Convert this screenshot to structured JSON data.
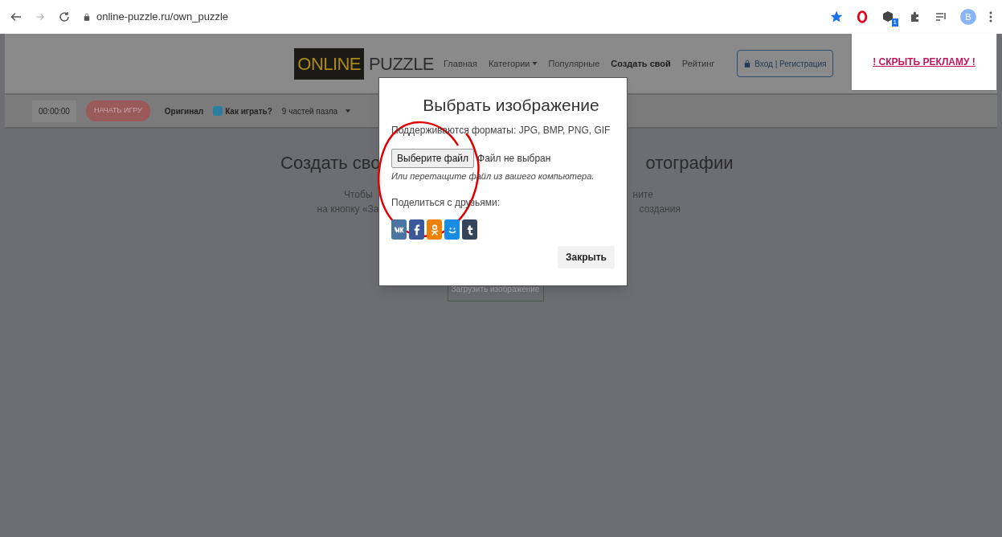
{
  "browser": {
    "url": "online-puzzle.ru/own_puzzle",
    "profile": "B",
    "badge": "1"
  },
  "site": {
    "logo_left": "ONLINE",
    "logo_right": "PUZZLE",
    "nav": [
      {
        "label": "Главная",
        "selected": false,
        "dropdown": false
      },
      {
        "label": "Категории",
        "selected": false,
        "dropdown": true
      },
      {
        "label": "Популярные",
        "selected": false,
        "dropdown": false
      },
      {
        "label": "Создать свой",
        "selected": true,
        "dropdown": false
      },
      {
        "label": "Рейтинг",
        "selected": false,
        "dropdown": false
      }
    ],
    "login": "Вход | Регистрация"
  },
  "ad": {
    "link": "! СКРЫТЬ РЕКЛАМУ !"
  },
  "toolbar": {
    "timer": "00:00:00",
    "start": "НАЧАТЬ ИГРУ",
    "original": "Оригинал",
    "help": "Как играть?",
    "pieces": "9 частей пазла"
  },
  "page": {
    "heading_left": "Создать сво",
    "heading_right": "отографии",
    "line1_left": "Чтобы",
    "line1_right": "ните",
    "line2_left": "на кнопку «За",
    "line2_right": "создания",
    "upload": "Загрузить изображение"
  },
  "modal": {
    "title": "Выбрать изображение",
    "formats": "Поддерживаются форматы: JPG, BMP, PNG, GIF",
    "file_button": "Выберите файл",
    "file_status": "Файл не выбран",
    "drop_hint": "Или перетащите файл из вашего компьютера.",
    "share_label": "Поделиться с друзьями:",
    "share": [
      {
        "kind": "vk",
        "color": "#4c75a3"
      },
      {
        "kind": "facebook",
        "color": "#3b5998"
      },
      {
        "kind": "ok",
        "color": "#ee8208"
      },
      {
        "kind": "mailru",
        "color": "#168de2"
      },
      {
        "kind": "tumblr",
        "color": "#35465c"
      }
    ],
    "close": "Закрыть"
  }
}
